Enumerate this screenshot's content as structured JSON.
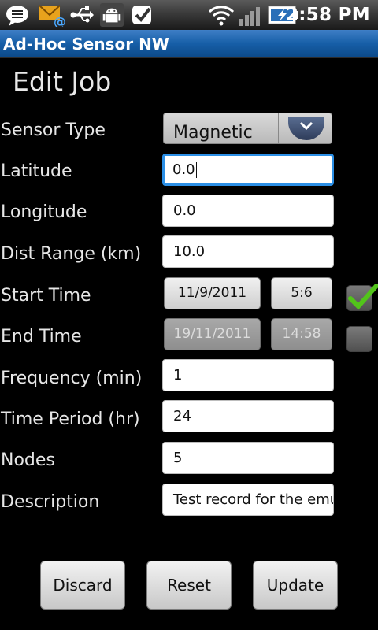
{
  "status_bar": {
    "time": "2:58 PM",
    "icons": [
      "chat-icon",
      "email-icon",
      "usb-icon",
      "android-debug-icon",
      "checkmark-icon",
      "wifi-icon",
      "signal-icon",
      "battery-charging-icon"
    ]
  },
  "app": {
    "title": "Ad-Hoc Sensor NW"
  },
  "form": {
    "heading": "Edit Job",
    "sensor_type": {
      "label": "Sensor Type",
      "value": "Magnetic"
    },
    "latitude": {
      "label": "Latitude",
      "value": "0.0"
    },
    "longitude": {
      "label": "Longitude",
      "value": "0.0"
    },
    "dist_range": {
      "label": "Dist Range (km)",
      "value": "10.0"
    },
    "start_time": {
      "label": "Start Time",
      "date": "11/9/2011",
      "time": "5:6",
      "checked": true
    },
    "end_time": {
      "label": "End Time",
      "date": "19/11/2011",
      "time": "14:58",
      "checked": false
    },
    "frequency": {
      "label": "Frequency (min)",
      "value": "1"
    },
    "time_period": {
      "label": "Time Period (hr)",
      "value": "24"
    },
    "nodes": {
      "label": "Nodes",
      "value": "5"
    },
    "description": {
      "label": "Description",
      "value": "Test record for the emu"
    }
  },
  "actions": {
    "discard": "Discard",
    "reset": "Reset",
    "update": "Update"
  },
  "colors": {
    "title_bar": "#175fa8",
    "focus": "#2b8fe6",
    "check": "#52c41a"
  }
}
